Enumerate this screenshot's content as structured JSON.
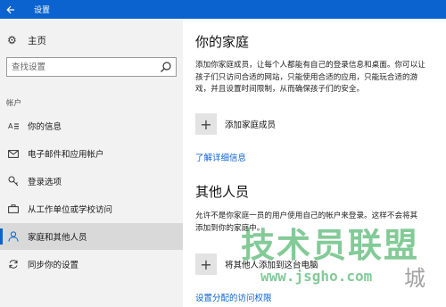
{
  "window": {
    "title": "设置"
  },
  "sidebar": {
    "home_label": "主页",
    "search_placeholder": "查找设置",
    "section_label": "帐户",
    "items": [
      {
        "label": "你的信息",
        "icon": "person-card-icon"
      },
      {
        "label": "电子邮件和应用帐户",
        "icon": "mail-icon"
      },
      {
        "label": "登录选项",
        "icon": "key-icon"
      },
      {
        "label": "从工作单位或学校访问",
        "icon": "briefcase-icon"
      },
      {
        "label": "家庭和其他人员",
        "icon": "person-icon",
        "selected": true
      },
      {
        "label": "同步你的设置",
        "icon": "sync-icon"
      }
    ]
  },
  "main": {
    "family": {
      "heading": "你的家庭",
      "desc_lines": [
        "添加你家庭成员，让每个人都能有自己的登录信息和桌面。你可以让",
        "孩子们只访问合适的网站，只能使用合适的应用，只能玩合适的游",
        "戏，并且设置时间限制，从而确保孩子们的安全。"
      ],
      "add_label": "添加家庭成员",
      "learn_more": "了解详细信息"
    },
    "others": {
      "heading": "其他人员",
      "desc_lines": [
        "允许不是你家庭一员的用户使用自己的帐户来登录。这样不会将其",
        "添加到你的家庭中。"
      ],
      "add_label": "将其他人添加到这台电脑",
      "assigned_access_link": "设置分配的访问权限"
    }
  },
  "watermark": {
    "main": "技术员联盟",
    "url": "www.jsgho.com",
    "ext": "城"
  },
  "colors": {
    "accent": "#0a63cf",
    "titlebar": "#0a63cf",
    "sidebar_bg": "#f2f2f2",
    "selected_bg": "#d9d9d9"
  }
}
